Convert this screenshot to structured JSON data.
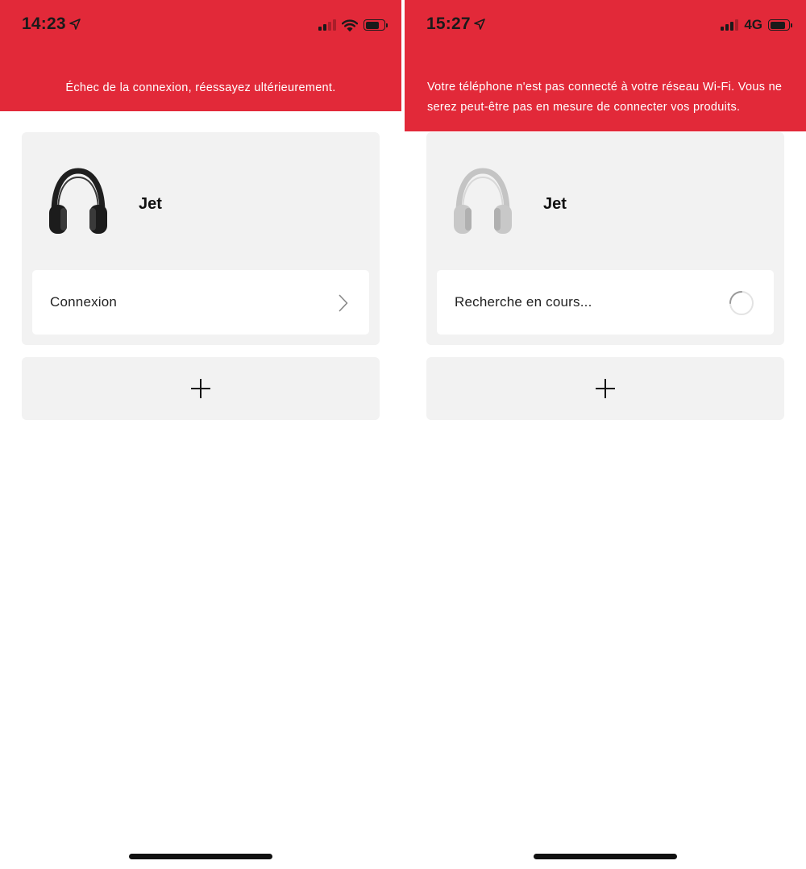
{
  "colors": {
    "banner": "#e22939",
    "card": "#f2f2f2",
    "text": "#111111"
  },
  "left": {
    "status": {
      "time": "14:23",
      "network": "wifi",
      "signal_bars_active": 2,
      "battery_level": 0.75
    },
    "banner": {
      "message": "Échec de la connexion, réessayez ultérieurement."
    },
    "device": {
      "name": "Jet",
      "icon": "headphones-black-icon",
      "action": {
        "label": "Connexion",
        "icon": "chevron-right-icon"
      }
    },
    "add_card": {
      "icon": "plus-icon"
    }
  },
  "right": {
    "status": {
      "time": "15:27",
      "network": "4G",
      "signal_bars_active": 3,
      "battery_level": 0.85
    },
    "banner": {
      "message": "Votre téléphone n'est pas connecté à votre réseau Wi-Fi. Vous ne serez peut-être pas en mesure de connecter vos produits."
    },
    "device": {
      "name": "Jet",
      "icon": "headphones-silver-icon",
      "action": {
        "label": "Recherche en cours...",
        "icon": "loading-spinner-icon"
      }
    },
    "add_card": {
      "icon": "plus-icon"
    }
  }
}
